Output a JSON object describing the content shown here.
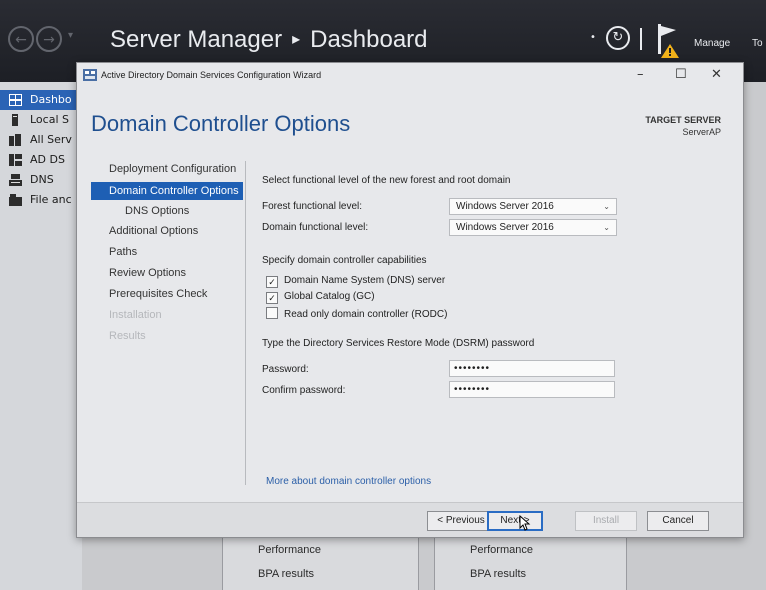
{
  "server_manager": {
    "title": "Server Manager",
    "separator": "▸",
    "page": "Dashboard",
    "menu_manage": "Manage",
    "menu_tools": "To",
    "nav_items": [
      {
        "label": "Dashbo",
        "icon": "dashboard-icon",
        "active": true
      },
      {
        "label": "Local S",
        "icon": "server-icon",
        "active": false
      },
      {
        "label": "All Serv",
        "icon": "servers-icon",
        "active": false
      },
      {
        "label": "AD DS",
        "icon": "ad-ds-icon",
        "active": false
      },
      {
        "label": "DNS",
        "icon": "dns-icon",
        "active": false
      },
      {
        "label": "File anc",
        "icon": "file-services-icon",
        "active": false
      }
    ],
    "background_rows": {
      "col1": [
        "Performance",
        "BPA results"
      ],
      "col2": [
        "Performance",
        "BPA results"
      ]
    }
  },
  "wizard": {
    "title": "Active Directory Domain Services Configuration Wizard",
    "heading": "Domain Controller Options",
    "target_server_label": "TARGET SERVER",
    "target_server_name": "ServerAP",
    "steps": [
      {
        "label": "Deployment Configuration",
        "state": "normal"
      },
      {
        "label": "Domain Controller Options",
        "state": "current"
      },
      {
        "label": "DNS Options",
        "state": "normal"
      },
      {
        "label": "Additional Options",
        "state": "normal"
      },
      {
        "label": "Paths",
        "state": "normal"
      },
      {
        "label": "Review Options",
        "state": "normal"
      },
      {
        "label": "Prerequisites Check",
        "state": "normal"
      },
      {
        "label": "Installation",
        "state": "dim"
      },
      {
        "label": "Results",
        "state": "dim"
      }
    ],
    "functional_level_heading": "Select functional level of the new forest and root domain",
    "forest_level_label": "Forest functional level:",
    "forest_level_value": "Windows Server 2016",
    "domain_level_label": "Domain functional level:",
    "domain_level_value": "Windows Server 2016",
    "capabilities_heading": "Specify domain controller capabilities",
    "capabilities": [
      {
        "label": "Domain Name System (DNS) server",
        "checked": true
      },
      {
        "label": "Global Catalog (GC)",
        "checked": true
      },
      {
        "label": "Read only domain controller (RODC)",
        "checked": false
      }
    ],
    "dsrm_heading": "Type the Directory Services Restore Mode (DSRM) password",
    "password_label": "Password:",
    "password_value": "••••••••",
    "confirm_password_label": "Confirm password:",
    "confirm_password_value": "••••••••",
    "more_link": "More about domain controller options",
    "buttons": {
      "previous": "< Previous",
      "next": "Next >",
      "install": "Install",
      "cancel": "Cancel"
    },
    "window_controls": {
      "minimize": "–",
      "maximize": "☐",
      "close": "✕"
    }
  }
}
